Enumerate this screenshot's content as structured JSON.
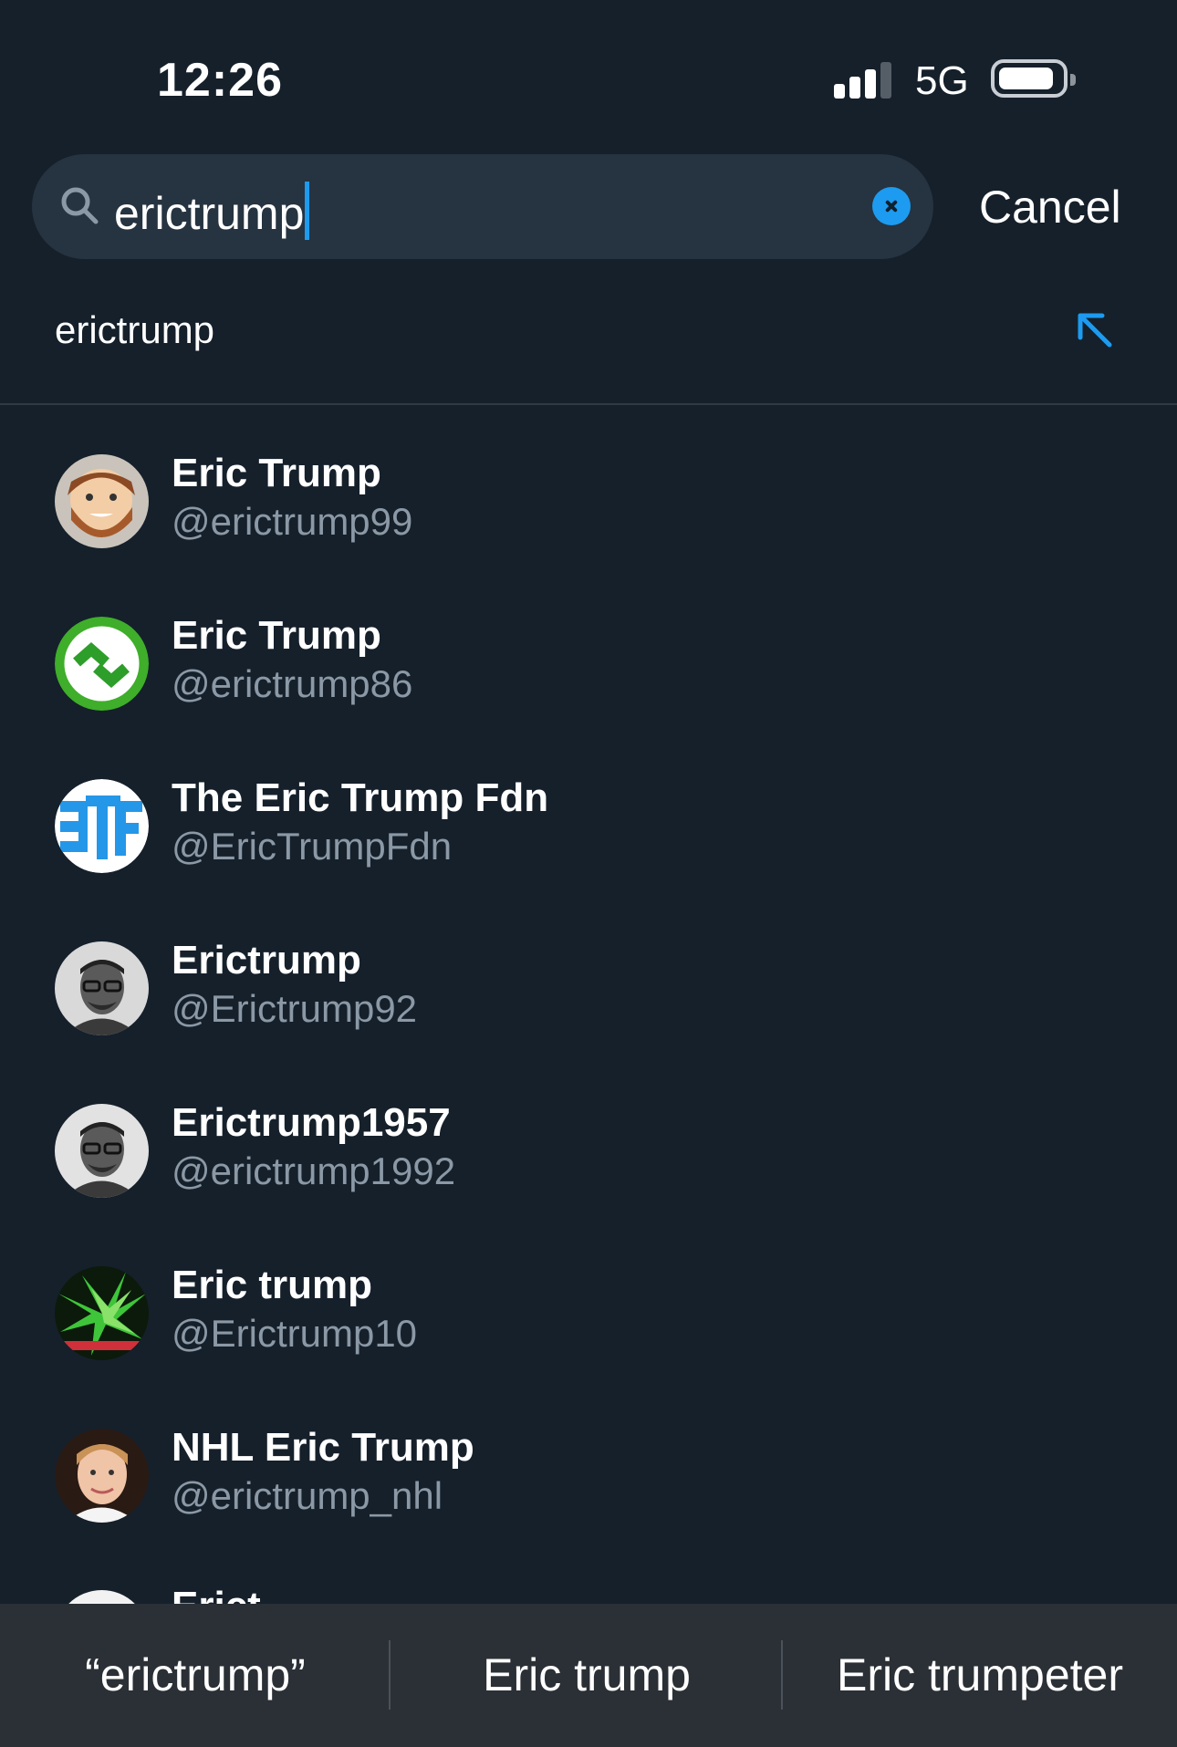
{
  "status_bar": {
    "time": "12:26",
    "network": "5G"
  },
  "search": {
    "query": "erictrump",
    "cancel_label": "Cancel"
  },
  "suggestion": {
    "label": "erictrump"
  },
  "results": [
    {
      "name": "Eric Trump",
      "handle": "@erictrump99"
    },
    {
      "name": "Eric Trump",
      "handle": "@erictrump86"
    },
    {
      "name": "The Eric Trump Fdn",
      "handle": "@EricTrumpFdn"
    },
    {
      "name": "Erictrump",
      "handle": "@Erictrump92"
    },
    {
      "name": "Erictrump1957",
      "handle": "@erictrump1992"
    },
    {
      "name": "Eric trump",
      "handle": "@Erictrump10"
    },
    {
      "name": "NHL Eric Trump",
      "handle": "@erictrump_nhl"
    }
  ],
  "partial_result": {
    "name": "Erict"
  },
  "keyboard_predictions": [
    "“erictrump”",
    "Eric trump",
    "Eric trumpeter"
  ],
  "colors": {
    "background": "#15202b",
    "accent": "#1d9bf0",
    "secondary_text": "#8b98a5"
  }
}
